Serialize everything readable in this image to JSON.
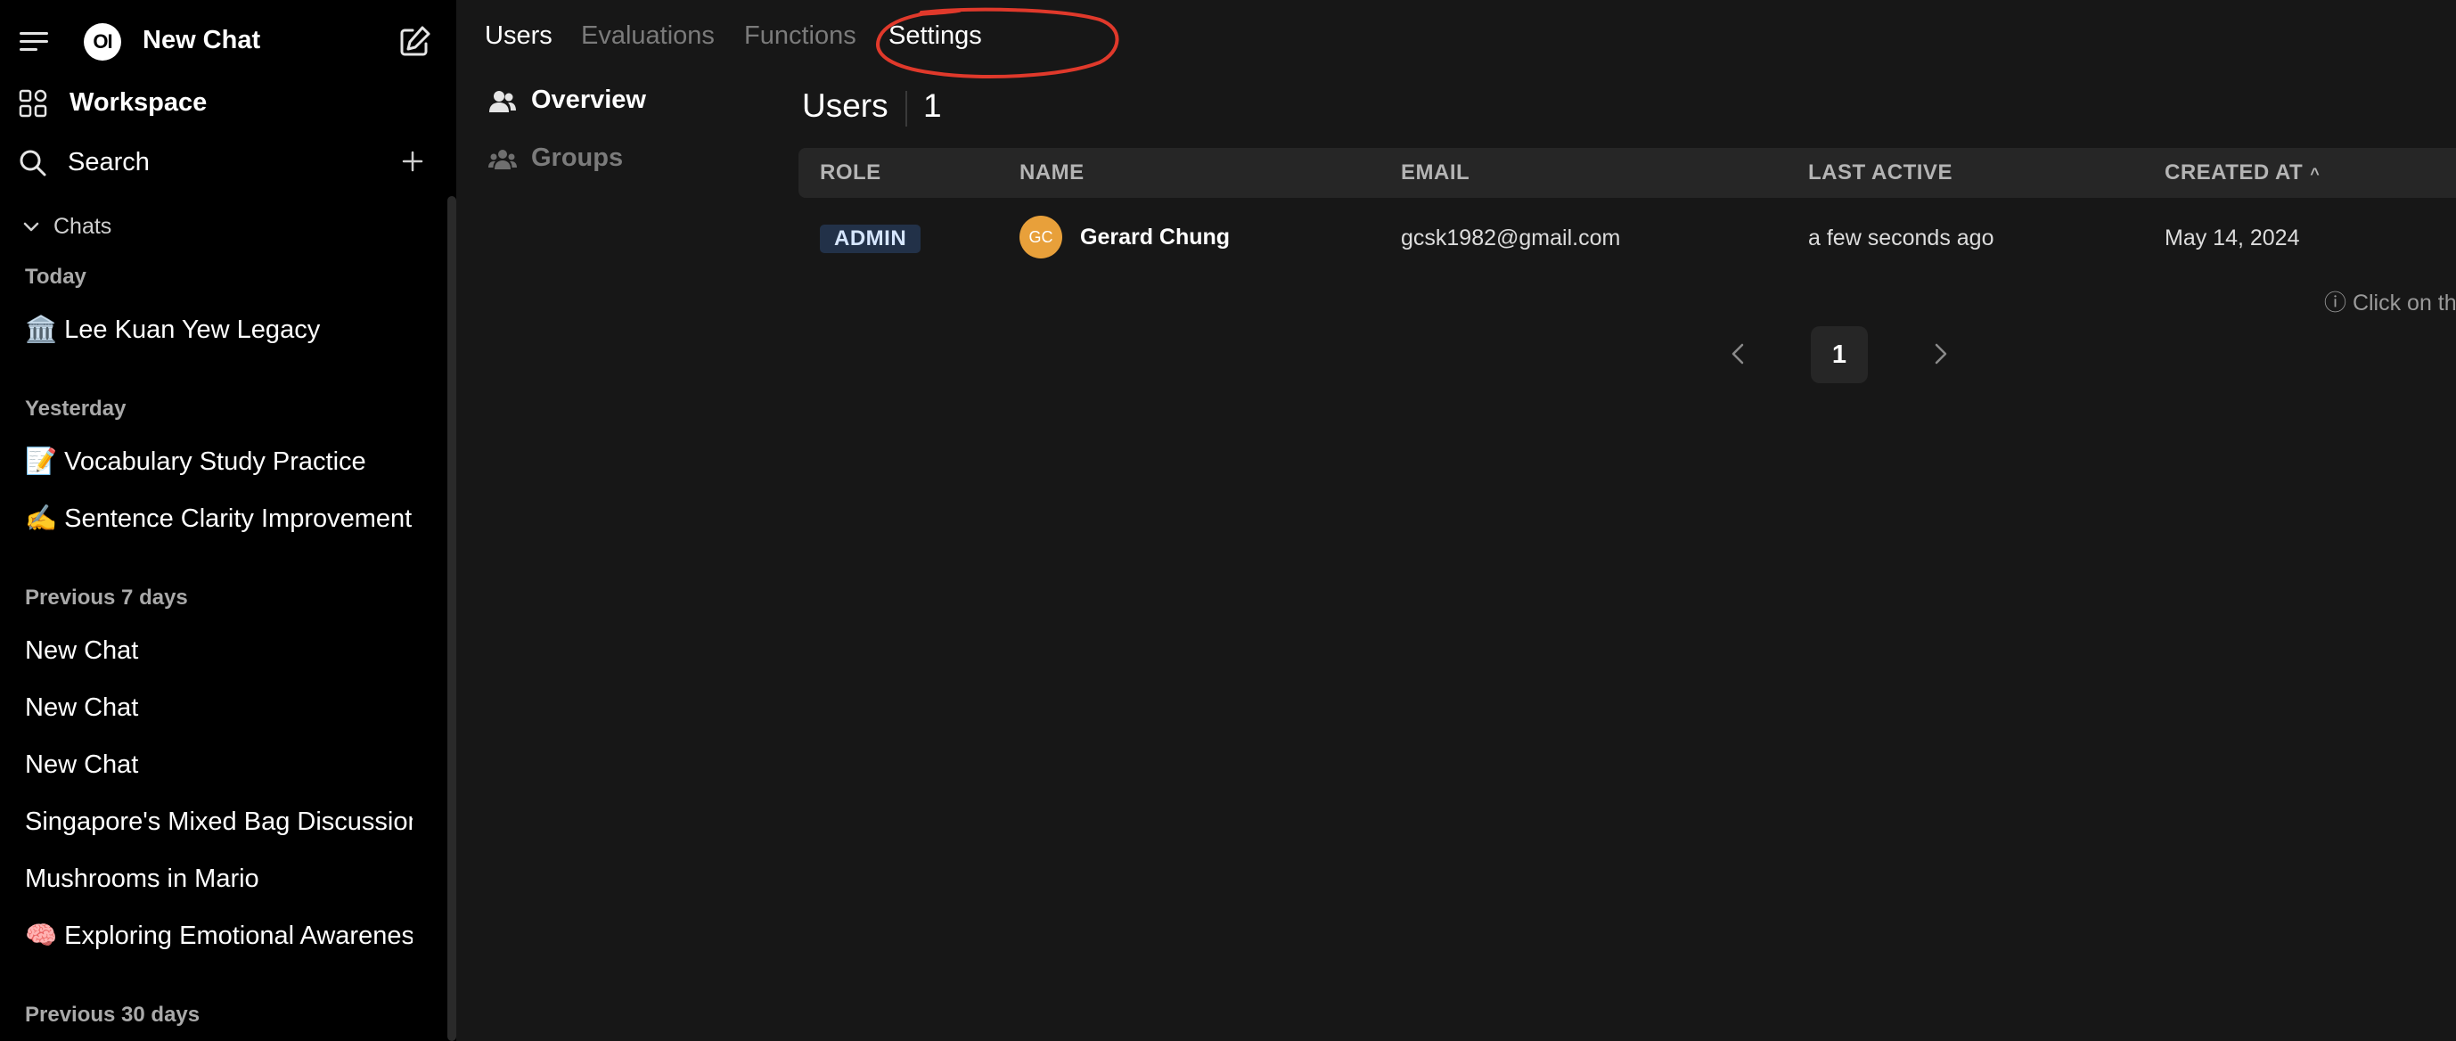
{
  "sidebar": {
    "title": "New Chat",
    "logo_text": "OI",
    "workspace_label": "Workspace",
    "search_label": "Search",
    "chats_label": "Chats",
    "groups": [
      {
        "label": "Today",
        "items": [
          "🏛️ Lee Kuan Yew Legacy"
        ]
      },
      {
        "label": "Yesterday",
        "items": [
          "📝 Vocabulary Study Practice",
          "✍️ Sentence Clarity Improvement"
        ]
      },
      {
        "label": "Previous 7 days",
        "items": [
          "New Chat",
          "New Chat",
          "New Chat",
          "Singapore's Mixed Bag Discussion",
          "Mushrooms in Mario",
          "🧠 Exploring Emotional Awareness"
        ]
      },
      {
        "label": "Previous 30 days",
        "items": []
      }
    ],
    "icons": [
      "menu-icon",
      "compose-icon",
      "workspace-icon",
      "search-icon",
      "plus-icon",
      "chevron-down-icon"
    ]
  },
  "tabs": [
    {
      "label": "Users",
      "active": true
    },
    {
      "label": "Evaluations",
      "active": false
    },
    {
      "label": "Functions",
      "active": false
    },
    {
      "label": "Settings",
      "active": true
    }
  ],
  "subnav": [
    {
      "label": "Overview",
      "icon": "users-icon",
      "active": true
    },
    {
      "label": "Groups",
      "icon": "user-group-icon",
      "active": false
    }
  ],
  "main": {
    "heading": "Users",
    "count": "1",
    "columns": [
      "ROLE",
      "NAME",
      "EMAIL",
      "LAST ACTIVE",
      "CREATED AT"
    ],
    "sort_indicator": "^",
    "rows": [
      {
        "role": "ADMIN",
        "avatar_initials": "GC",
        "name": "Gerard Chung",
        "email": "gcsk1982@gmail.com",
        "last_active": "a few seconds ago",
        "created_at": "May 14, 2024"
      }
    ],
    "hint": "ⓘ Click on th",
    "page": "1"
  },
  "colors": {
    "background": "#171717",
    "sidebar": "#000000",
    "annotation": "#e0392b",
    "admin_badge": "#223148",
    "avatar": "#e8a03a"
  }
}
